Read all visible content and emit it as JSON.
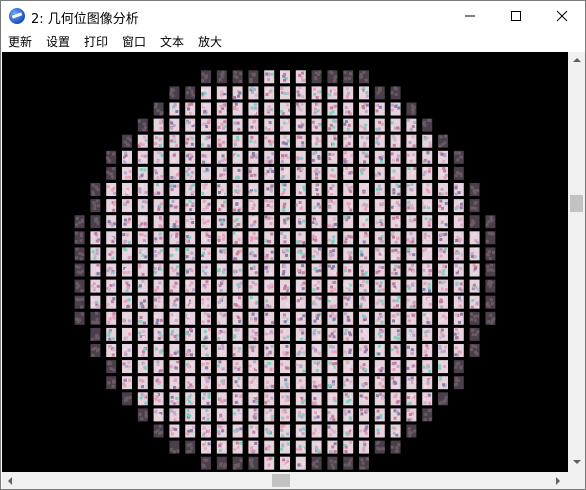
{
  "window": {
    "title": "2: 几何位图像分析",
    "app_icon": "app-logo-icon",
    "controls": [
      "minimize-icon",
      "maximize-icon",
      "close-icon"
    ]
  },
  "menubar": {
    "items": [
      {
        "label": "更新"
      },
      {
        "label": "设置"
      },
      {
        "label": "打印"
      },
      {
        "label": "窗口"
      },
      {
        "label": "文本"
      },
      {
        "label": "放大"
      }
    ]
  },
  "canvas": {
    "background": "#000000",
    "content": "circular grid of small die thumbnail images",
    "grid_columns": 27,
    "grid_rows": 25,
    "tile_colors": [
      "#d9b3c8",
      "#c27fa0",
      "#f0d9e5",
      "#8a7fa6",
      "#b8a9c9",
      "#e8a0b8",
      "#7fd0c0"
    ]
  },
  "scrollbars": {
    "vertical_position": 0.35,
    "horizontal_position": 0.48
  }
}
